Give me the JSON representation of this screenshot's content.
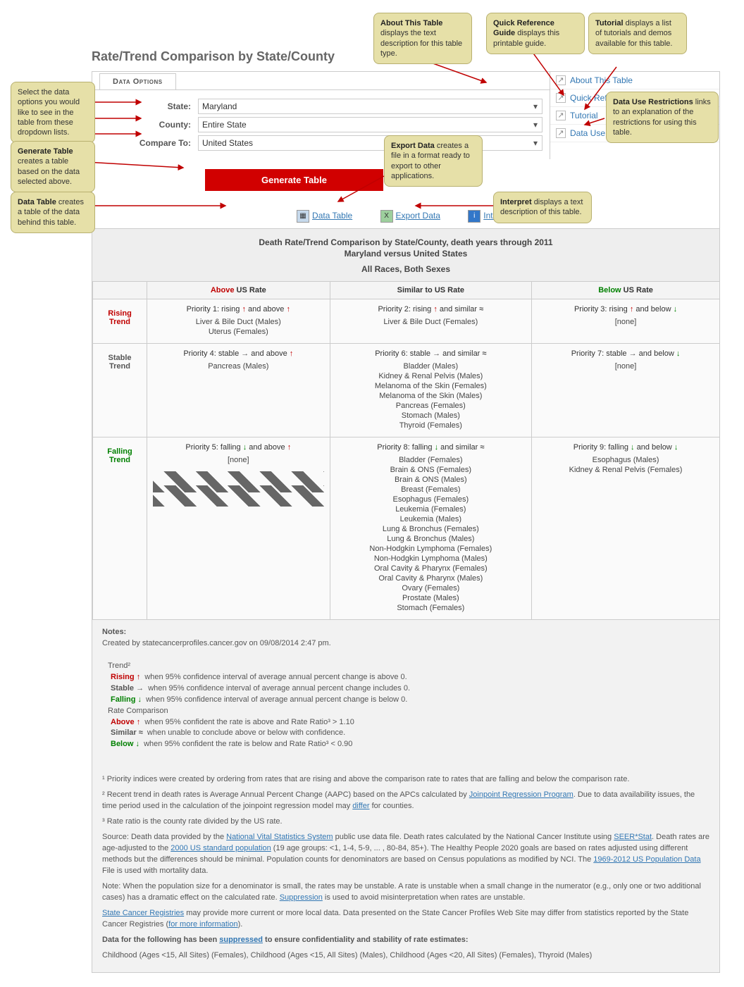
{
  "title": "Rate/Trend Comparison by State/County",
  "tabs": {
    "data_options": "Data Options"
  },
  "form": {
    "state_label": "State:",
    "state_value": "Maryland",
    "county_label": "County:",
    "county_value": "Entire State",
    "compare_label": "Compare To:",
    "compare_value": "United States"
  },
  "generate_btn": "Generate Table",
  "side_links": {
    "about": "About This Table",
    "guide": "Quick Reference Guide",
    "tutorial": "Tutorial",
    "restrict": "Data Use Restrictions"
  },
  "sub_links": {
    "data_table": "Data Table",
    "export": "Export Data",
    "interpret": "Interpret"
  },
  "report": {
    "title": "Death Rate/Trend Comparison by State/County, death years through 2011",
    "versus": "Maryland versus United States",
    "demo": "All Races, Both Sexes",
    "col_above": "Above US Rate",
    "col_similar": "Similar to US Rate",
    "col_below": "Below US Rate",
    "row_rising": "Rising Trend",
    "row_stable": "Stable Trend",
    "row_falling": "Falling Trend",
    "cells": {
      "p1": {
        "label": "Priority 1: rising ↑ and above ↑",
        "items": [
          "Liver & Bile Duct (Males)",
          "Uterus (Females)"
        ]
      },
      "p2": {
        "label": "Priority 2: rising ↑ and similar ≈",
        "items": [
          "Liver & Bile Duct (Females)"
        ]
      },
      "p3": {
        "label": "Priority 3: rising ↑ and below ↓",
        "items": [
          "[none]"
        ]
      },
      "p4": {
        "label": "Priority 4: stable → and above ↑",
        "items": [
          "Pancreas (Males)"
        ]
      },
      "p5": {
        "label": "Priority 5: falling ↓ and above ↑",
        "items": [
          "[none]"
        ]
      },
      "p6": {
        "label": "Priority 6: stable → and similar ≈",
        "items": [
          "Bladder (Males)",
          "Kidney & Renal Pelvis (Males)",
          "Melanoma of the Skin (Females)",
          "Melanoma of the Skin (Males)",
          "Pancreas (Females)",
          "Stomach (Males)",
          "Thyroid (Females)"
        ]
      },
      "p7": {
        "label": "Priority 7: stable → and below ↓",
        "items": [
          "[none]"
        ]
      },
      "p8": {
        "label": "Priority 8: falling ↓ and similar ≈",
        "items": [
          "Bladder (Females)",
          "Brain & ONS (Females)",
          "Brain & ONS (Males)",
          "Breast (Females)",
          "Esophagus (Females)",
          "Leukemia (Females)",
          "Leukemia (Males)",
          "Lung & Bronchus (Females)",
          "Lung & Bronchus (Males)",
          "Non-Hodgkin Lymphoma (Females)",
          "Non-Hodgkin Lymphoma (Males)",
          "Oral Cavity & Pharynx (Females)",
          "Oral Cavity & Pharynx (Males)",
          "Ovary (Females)",
          "Prostate (Males)",
          "Stomach (Females)"
        ]
      },
      "p9": {
        "label": "Priority 9: falling ↓ and below ↓",
        "items": [
          "Esophagus (Males)",
          "Kidney & Renal Pelvis (Females)"
        ]
      }
    }
  },
  "notes": {
    "header": "Notes:",
    "created": "Created by statecancerprofiles.cancer.gov on 09/08/2014 2:47 pm.",
    "trend_label": "Trend²",
    "rising_lbl": "Rising",
    "rising_txt": "when 95% confidence interval of average annual percent change is above 0.",
    "stable_lbl": "Stable",
    "stable_txt": "when 95% confidence interval of average annual percent change includes 0.",
    "falling_lbl": "Falling",
    "falling_txt": "when 95% confidence interval of average annual percent change is below 0.",
    "rate_label": "Rate Comparison",
    "above_lbl": "Above",
    "above_txt": "when 95% confident the rate is above and Rate Ratio³ > 1.10",
    "similar_lbl": "Similar",
    "similar_txt": "when unable to conclude above or below with confidence.",
    "below_lbl": "Below",
    "below_txt": "when 95% confident the rate is below and Rate Ratio³ < 0.90"
  },
  "footnotes": {
    "f1": "¹ Priority indices were created by ordering from rates that are rising and above the comparison rate to rates that are falling and below the comparison rate.",
    "f2a": "² Recent trend in death rates is Average Annual Percent Change (AAPC) based on the APCs calculated by ",
    "f2_link1": "Joinpoint Regression Program",
    "f2b": ". Due to data availability issues, the time period used in the calculation of the joinpoint regression model may ",
    "f2_link2": "differ",
    "f2c": " for counties.",
    "f3": "³ Rate ratio is the county rate divided by the US rate.",
    "src_a": "Source: Death data provided by the ",
    "src_link1": "National Vital Statistics System",
    "src_b": " public use data file. Death rates calculated by the National Cancer Institute using ",
    "src_link2": "SEER*Stat",
    "src_c": ". Death rates are age-adjusted to the ",
    "src_link3": "2000 US standard population",
    "src_d": " (19 age groups: <1, 1-4, 5-9, ... , 80-84, 85+). The Healthy People 2020 goals are based on rates adjusted using different methods but the differences should be minimal. Population counts for denominators are based on Census populations as modified by NCI. The ",
    "src_link4": "1969-2012 US Population Data",
    "src_e": " File is used with mortality data.",
    "note_a": "Note: When the population size for a denominator is small, the rates may be unstable. A rate is unstable when a small change in the numerator (e.g., only one or two additional cases) has a dramatic effect on the calculated rate. ",
    "note_link1": "Suppression",
    "note_b": " is used to avoid misinterpretation when rates are unstable.",
    "reg_link1": "State Cancer Registries",
    "reg_a": " may provide more current or more local data. Data presented on the State Cancer Profiles Web Site may differ from statistics reported by the State Cancer Registries (",
    "reg_link2": "for more information",
    "reg_b": ").",
    "supp_hdr_a": "Data for the following has been ",
    "supp_link": "suppressed",
    "supp_hdr_b": " to ensure confidentiality and stability of rate estimates:",
    "supp_list": "Childhood (Ages <15, All Sites) (Females), Childhood (Ages <15, All Sites) (Males), Childhood (Ages <20, All Sites) (Females), Thyroid (Males)"
  },
  "callouts": {
    "about": "displays the text description for this table type.",
    "guide": "displays this printable guide.",
    "tutorial": "displays a list of tutorials and demos available for this table.",
    "restrict": "links to an explanation of the restrictions for using this table.",
    "options": "Select the data options you would like to see in the table from these dropdown lists.",
    "generate_a": "Generate Table",
    "generate_b": "creates a table based on the data selected above.",
    "export_a": "Export  Data",
    "export_b": "creates a file in a format ready to export to other applications.",
    "dtable_a": "Data Table",
    "dtable_b": "creates a table of the data behind this table.",
    "interpret_a": "Interpret",
    "interpret_b": "displays a text description of this table."
  }
}
